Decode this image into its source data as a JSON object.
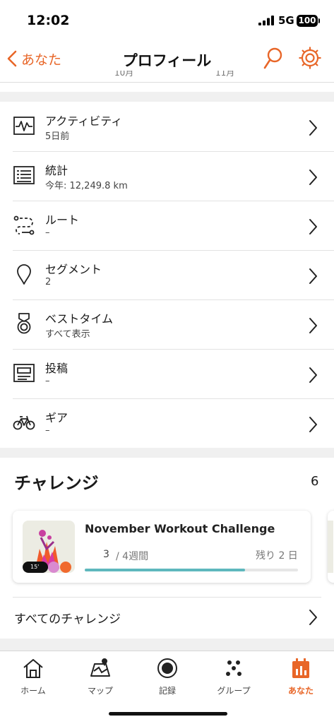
{
  "status_bar": {
    "time": "12:02",
    "network": "5G",
    "battery": "100"
  },
  "nav": {
    "back_label": "あなた",
    "title": "プロフィール"
  },
  "chart_axis": {
    "labels": [
      "10月",
      "11月"
    ]
  },
  "menu": {
    "items": [
      {
        "title": "アクティビティ",
        "subtitle": "5日前",
        "icon": "activity-chart-icon"
      },
      {
        "title": "統計",
        "subtitle": "今年: 12,249.8 km",
        "icon": "statistics-icon"
      },
      {
        "title": "ルート",
        "subtitle": "–",
        "icon": "route-icon"
      },
      {
        "title": "セグメント",
        "subtitle": "2",
        "icon": "segment-pin-icon"
      },
      {
        "title": "ベストタイム",
        "subtitle": "すべて表示",
        "icon": "medal-icon"
      },
      {
        "title": "投稿",
        "subtitle": "–",
        "icon": "post-icon"
      },
      {
        "title": "ギア",
        "subtitle": "–",
        "icon": "bicycle-icon"
      }
    ]
  },
  "challenges": {
    "heading": "チャレンジ",
    "count": "6",
    "card": {
      "title": "November Workout Challenge",
      "progress_value": "3",
      "progress_goal": "/ 4週間",
      "remaining": "残り 2 日",
      "progress_fraction": 0.75,
      "badge_text": "15'"
    },
    "all_label": "すべてのチャレンジ"
  },
  "tabs": [
    {
      "label": "ホーム",
      "icon": "home-icon"
    },
    {
      "label": "マップ",
      "icon": "map-icon"
    },
    {
      "label": "記録",
      "icon": "record-icon"
    },
    {
      "label": "グループ",
      "icon": "groups-icon"
    },
    {
      "label": "あなた",
      "icon": "you-icon",
      "active": true
    }
  ],
  "colors": {
    "accent": "#e86628",
    "progress": "#5eb8bd"
  }
}
